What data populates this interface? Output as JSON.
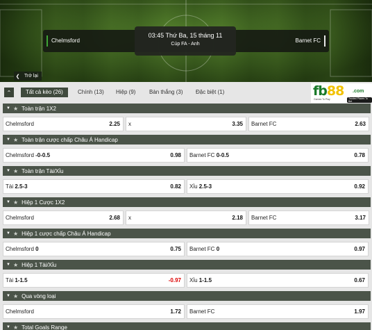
{
  "header": {
    "home_team": "Chelmsford",
    "away_team": "Barnet FC",
    "kickoff": "03:45 Thứ Ba, 15 tháng 11",
    "competition": "Cúp FA - Anh",
    "back_label": "Trở lại",
    "back_icon": "chevron-left-icon"
  },
  "tabs": [
    {
      "label": "Tất cả kèo (26)",
      "active": true
    },
    {
      "label": "Chính (13)",
      "active": false
    },
    {
      "label": "Hiệp (9)",
      "active": false
    },
    {
      "label": "Bàn thắng (3)",
      "active": false
    },
    {
      "label": "Đặc biệt (1)",
      "active": false
    }
  ],
  "logo": {
    "text_fb": "fb",
    "text_88": "88",
    "text_com": ".com",
    "tagline_1": "Games To Play",
    "tagline_2": "Trusted Places To Bet"
  },
  "colors": {
    "section_header": "#4b5449",
    "negative_odds": "#dd0000",
    "pitch": "#4b7a25"
  },
  "markets": [
    {
      "title": "Toàn trận 1X2",
      "cells": [
        {
          "label": "Chelmsford",
          "line": "",
          "odds": "2.25"
        },
        {
          "label": "x",
          "line": "",
          "odds": "3.35"
        },
        {
          "label": "Barnet FC",
          "line": "",
          "odds": "2.63"
        }
      ]
    },
    {
      "title": "Toàn trận cược chấp Châu Á Handicap",
      "cells": [
        {
          "label": "Chelmsford",
          "line": "-0-0.5",
          "odds": "0.98"
        },
        {
          "label": "Barnet FC",
          "line": "0-0.5",
          "odds": "0.78"
        }
      ]
    },
    {
      "title": "Toàn trận Tài/Xỉu",
      "cells": [
        {
          "label": "Tài",
          "line": "2.5-3",
          "odds": "0.82"
        },
        {
          "label": "Xỉu",
          "line": "2.5-3",
          "odds": "0.92"
        }
      ]
    },
    {
      "title": "Hiệp 1 Cược 1X2",
      "cells": [
        {
          "label": "Chelmsford",
          "line": "",
          "odds": "2.68"
        },
        {
          "label": "x",
          "line": "",
          "odds": "2.18"
        },
        {
          "label": "Barnet FC",
          "line": "",
          "odds": "3.17"
        }
      ]
    },
    {
      "title": "Hiệp 1 cược chấp Châu Á Handicap",
      "cells": [
        {
          "label": "Chelmsford",
          "line": "0",
          "odds": "0.75"
        },
        {
          "label": "Barnet FC",
          "line": "0",
          "odds": "0.97"
        }
      ]
    },
    {
      "title": "Hiệp 1 Tài/Xỉu",
      "cells": [
        {
          "label": "Tài",
          "line": "1-1.5",
          "odds": "-0.97"
        },
        {
          "label": "Xỉu",
          "line": "1-1.5",
          "odds": "0.67"
        }
      ]
    },
    {
      "title": "Qua vòng loại",
      "cells": [
        {
          "label": "Chelmsford",
          "line": "",
          "odds": "1.72"
        },
        {
          "label": "Barnet FC",
          "line": "",
          "odds": "1.97"
        }
      ]
    },
    {
      "title": "Total Goals Range",
      "cells": []
    }
  ]
}
